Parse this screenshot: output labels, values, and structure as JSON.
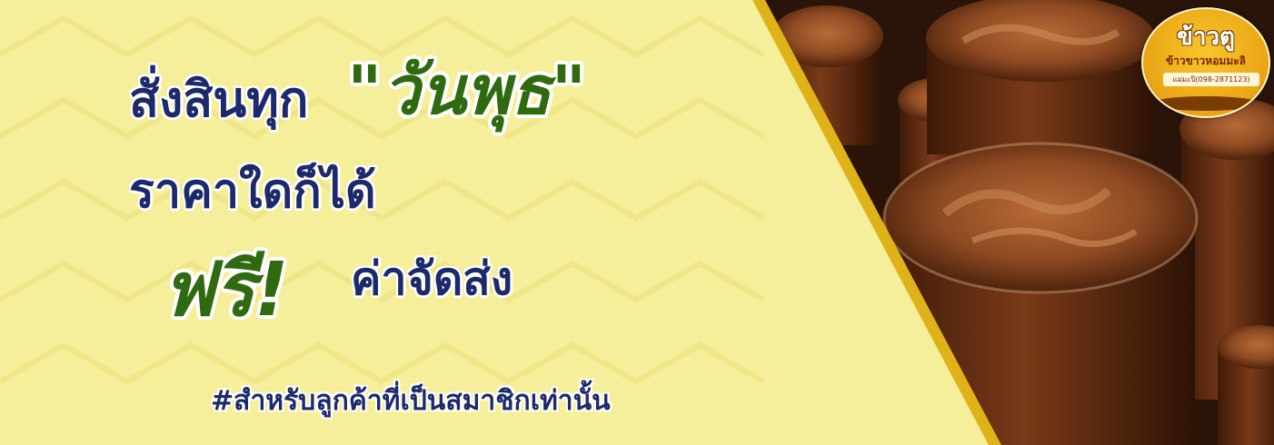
{
  "headline": {
    "line1": "สั่งสินทุก",
    "line1_highlight": "\"วันพุธ\"",
    "line2": "ราคาใดก็ได้",
    "line3_free": "ฟรี!",
    "line3_text": "ค่าจัดส่ง"
  },
  "footnote": "#สำหรับลูกค้าที่เป็นสมาชิกเท่านั้น",
  "logo": {
    "title": "ข้าวตู",
    "subtitle": "ข้าวขาวหอมมะลิ",
    "phone": "แม่มะปิ(098-2871123)"
  },
  "colors": {
    "background": "#f5ee9a",
    "headline": "#1c2a6b",
    "highlight": "#2f6a10",
    "divider": "#e0b21a"
  }
}
